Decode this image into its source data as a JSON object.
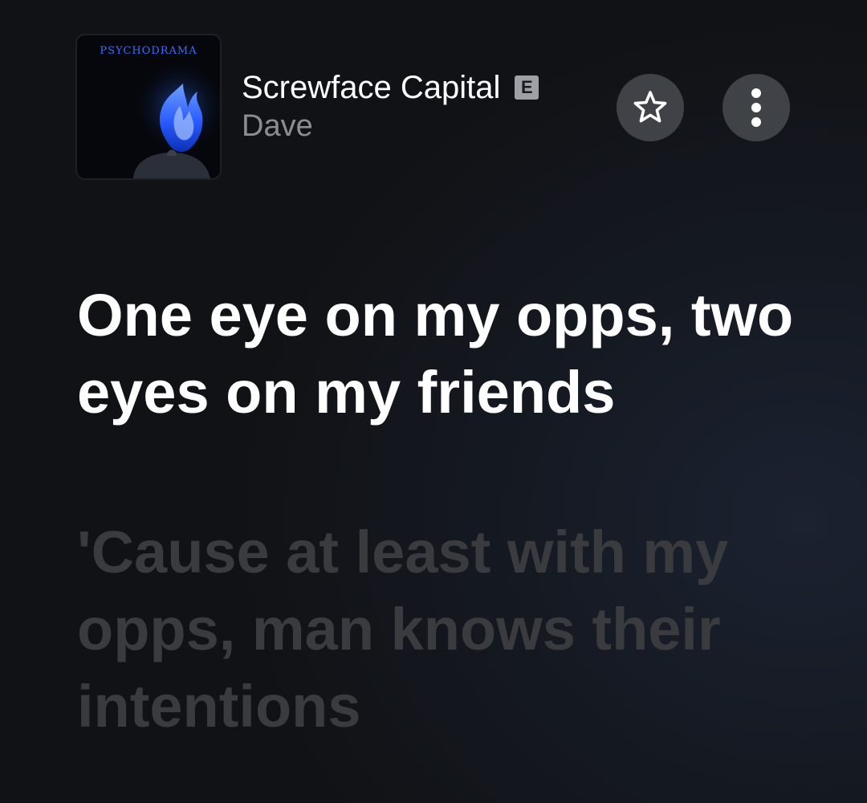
{
  "now_playing": {
    "album_art": {
      "lettering": "PSYCHODRAMA"
    },
    "track_title": "Screwface Capital",
    "explicit_badge": "E",
    "artist": "Dave"
  },
  "actions": {
    "favorite_icon": "star-outline-icon",
    "more_icon": "more-vertical-icon"
  },
  "lyrics": {
    "active_line": "One eye on my opps, two eyes on my friends",
    "next_line": "'Cause at least with my opps, man knows their intentions"
  },
  "colors": {
    "background": "#111215",
    "active_lyric": "#ffffff",
    "inactive_lyric": "#3a3b3f",
    "button_background": "#3f4247",
    "secondary_text": "#8b8d92",
    "album_flame": "#2f6bff"
  }
}
